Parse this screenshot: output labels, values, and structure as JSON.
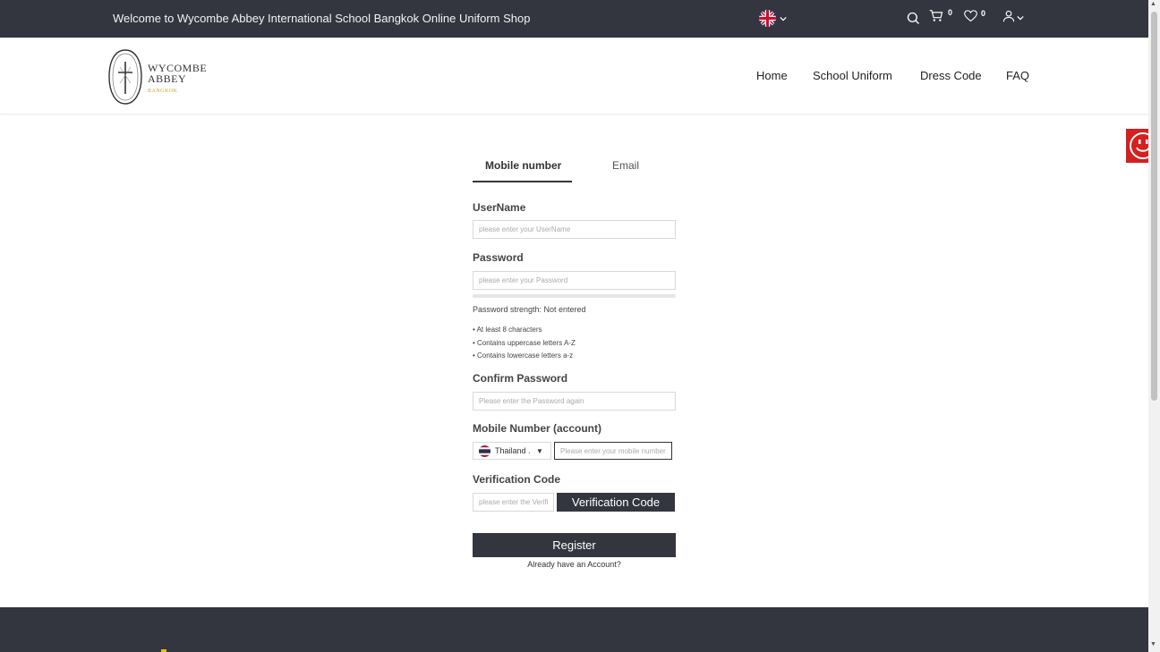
{
  "topbar": {
    "welcome": "Welcome to Wycombe Abbey International School Bangkok Online Uniform Shop",
    "language_icon": "uk-flag-icon",
    "cart_count": "0",
    "wishlist_count": "0"
  },
  "logo": {
    "line1": "WYCOMBE",
    "line2": "ABBEY",
    "line3": "BANGKOK"
  },
  "nav": {
    "home": "Home",
    "school_uniform": "School Uniform",
    "dress_code": "Dress Code",
    "faq": "FAQ"
  },
  "form": {
    "tabs": {
      "mobile": "Mobile number",
      "email": "Email"
    },
    "username_label": "UserName",
    "username_placeholder": "please enter your UserName",
    "password_label": "Password",
    "password_placeholder": "please enter your Password",
    "strength_text": "Password strength: Not entered",
    "rules": [
      "• At least 8 characters",
      "• Contains uppercase letters A-Z",
      "• Contains lowercase letters a-z"
    ],
    "confirm_label": "Confirm Password",
    "confirm_placeholder": "Please enter the Password again",
    "mobile_label": "Mobile Number (account)",
    "country": "Thailand ...",
    "mobile_placeholder": "Please enter your mobile number",
    "verification_label": "Verification Code",
    "verification_placeholder": "please enter the Verification Code",
    "verification_button": "Verification Code",
    "register_button": "Register",
    "login_link": "Already have an Account?"
  },
  "colors": {
    "dark": "#33363f",
    "chat_widget": "#d32020",
    "accent_gold": "#c9a227"
  }
}
